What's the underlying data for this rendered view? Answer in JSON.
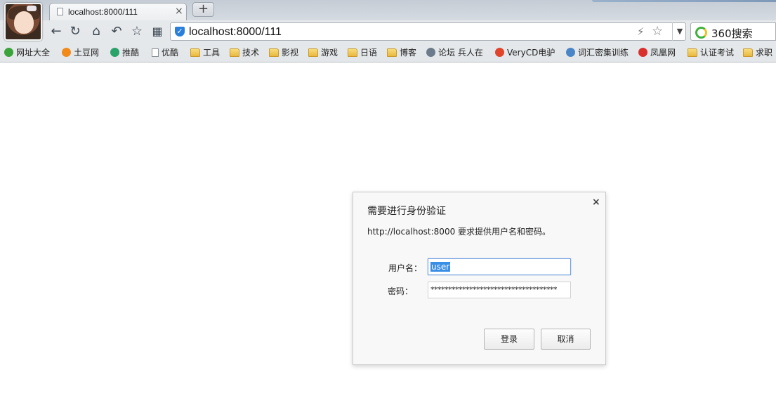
{
  "browser": {
    "tab": {
      "title": "localhost:8000/111",
      "close_glyph": "×"
    },
    "new_tab_glyph": "+",
    "url": "localhost:8000/111",
    "search_engine_label": "360搜索",
    "icons": {
      "back": "←",
      "reload": "↻",
      "home": "⌂",
      "undo": "↶",
      "favorite": "☆",
      "apps": "▦",
      "bolt": "⚡",
      "star": "☆",
      "dropdown": "▼",
      "shield": "✓"
    }
  },
  "bookmarks": [
    {
      "label": "网址大全",
      "icon": "green-plus-icon",
      "color": "#3aa33a"
    },
    {
      "label": "土豆网",
      "icon": "tudou-icon",
      "color": "#f28a1b"
    },
    {
      "label": "推酷",
      "icon": "tuicool-icon",
      "color": "#2aa36b"
    },
    {
      "label": "优酷",
      "icon": "page-icon",
      "color": "#ffffff"
    },
    {
      "label": "工具",
      "icon": "folder-icon",
      "color": "#f2c94c"
    },
    {
      "label": "技术",
      "icon": "folder-icon",
      "color": "#f2c94c"
    },
    {
      "label": "影视",
      "icon": "folder-icon",
      "color": "#f2c94c"
    },
    {
      "label": "游戏",
      "icon": "folder-icon",
      "color": "#f2c94c"
    },
    {
      "label": "日语",
      "icon": "folder-icon",
      "color": "#f2c94c"
    },
    {
      "label": "博客",
      "icon": "folder-icon",
      "color": "#f2c94c"
    },
    {
      "label": "论坛 兵人在",
      "icon": "forum-icon",
      "color": "#6b7b8c"
    },
    {
      "label": "VeryCD电驴",
      "icon": "verycd-icon",
      "color": "#e0452b"
    },
    {
      "label": "词汇密集训练",
      "icon": "vocab-icon",
      "color": "#4a86c7"
    },
    {
      "label": "凤凰网",
      "icon": "ifeng-icon",
      "color": "#d9302c"
    },
    {
      "label": "认证考试",
      "icon": "folder-icon",
      "color": "#f2c94c"
    },
    {
      "label": "求职",
      "icon": "folder-icon",
      "color": "#f2c94c"
    }
  ],
  "dialog": {
    "title": "需要进行身份验证",
    "message": "http://localhost:8000 要求提供用户名和密码。",
    "username_label": "用户名：",
    "username_value": "user",
    "password_label": "密码：",
    "password_value": "************************************",
    "login_label": "登录",
    "cancel_label": "取消",
    "close_glyph": "×"
  }
}
